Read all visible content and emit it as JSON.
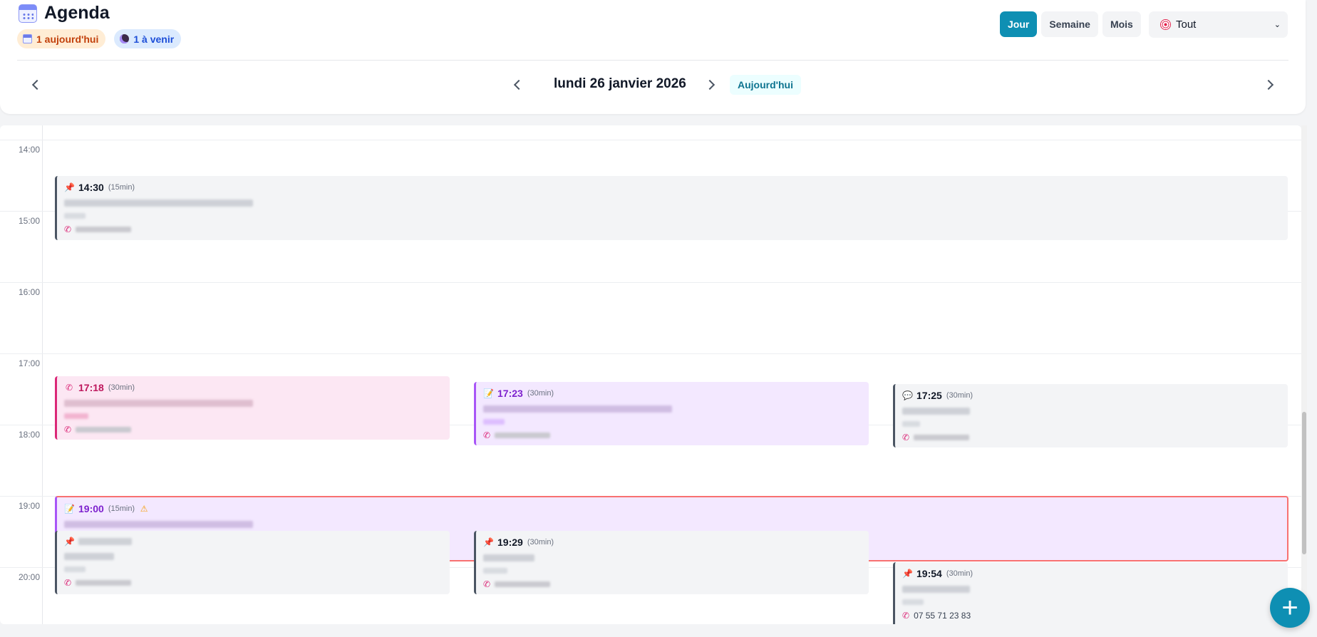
{
  "app": {
    "title": "Agenda"
  },
  "badges": {
    "today": "1 aujourd'hui",
    "upcoming": "1 à venir"
  },
  "views": {
    "day": "Jour",
    "week": "Semaine",
    "month": "Mois",
    "active": "Jour"
  },
  "filter": {
    "selected": "Tout"
  },
  "nav": {
    "current_date": "lundi 26 janvier 2026",
    "today_label": "Aujourd'hui"
  },
  "hours": [
    "14:00",
    "15:00",
    "16:00",
    "17:00",
    "18:00",
    "19:00",
    "20:00"
  ],
  "events": [
    {
      "time": "14:30",
      "duration": "(15min)",
      "color": "grey",
      "icon": "pin-icon"
    },
    {
      "time": "17:18",
      "duration": "(30min)",
      "color": "pink",
      "icon": "phone-icon"
    },
    {
      "time": "17:23",
      "duration": "(30min)",
      "color": "purple",
      "icon": "memo-icon"
    },
    {
      "time": "17:25",
      "duration": "(30min)",
      "color": "grey",
      "icon": "speech-icon"
    },
    {
      "time": "19:00",
      "duration": "(15min)",
      "color": "purple",
      "icon": "memo-icon",
      "warning": true
    },
    {
      "time": "19:29",
      "duration": "(30min)",
      "color": "grey",
      "icon": "pin-icon"
    },
    {
      "time": "19:54",
      "duration": "(30min)",
      "color": "grey",
      "icon": "pin-icon",
      "phone": "07 55 71 23 83"
    }
  ],
  "colors": {
    "accent": "#0e8fb3",
    "pink": "#db2777",
    "purple": "#a855f7",
    "alert": "#f87171"
  }
}
